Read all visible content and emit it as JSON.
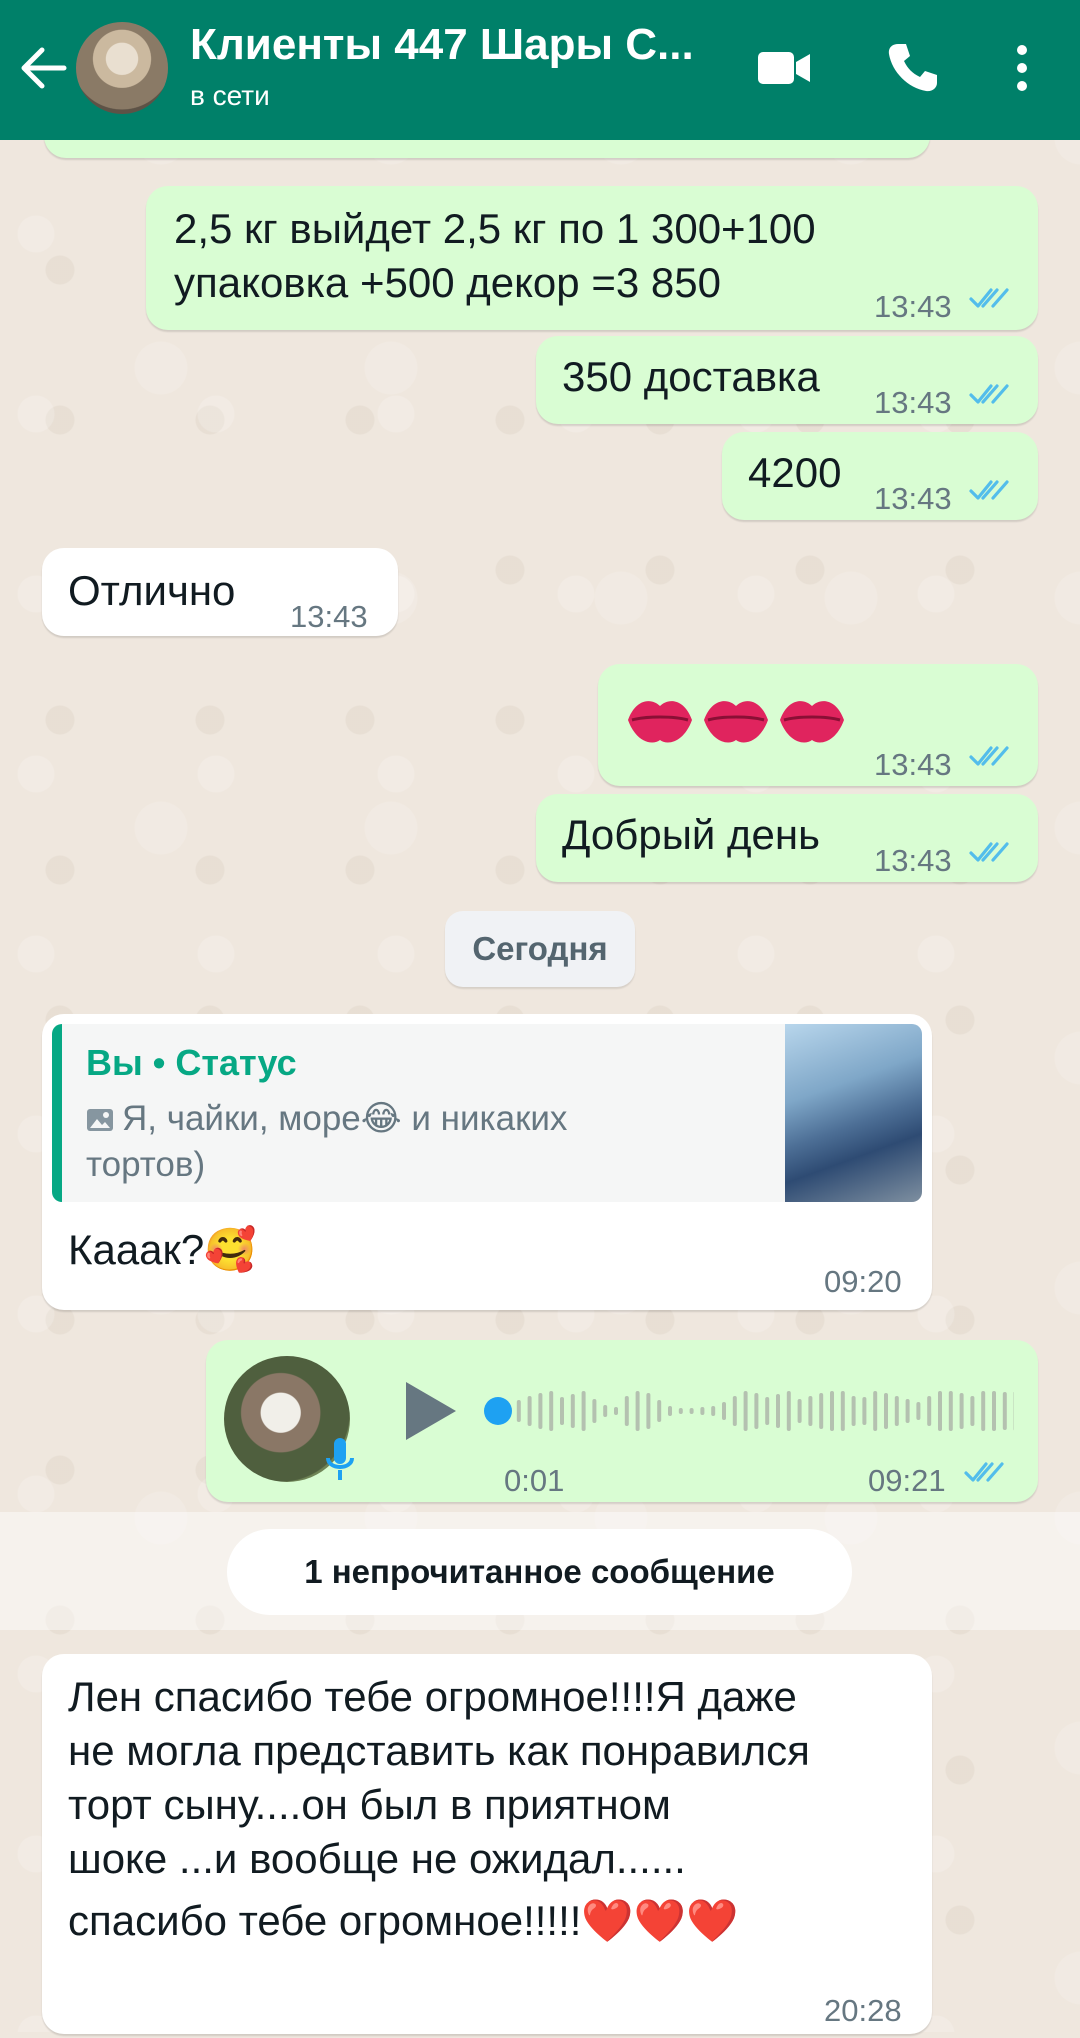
{
  "header": {
    "title": "Клиенты 447 Шары С...",
    "status": "в сети",
    "icons": [
      "arrow-left-icon",
      "video-call-icon",
      "phone-icon",
      "more-vert-icon"
    ]
  },
  "colors": {
    "header_bg": "#008069",
    "outgoing_bubble": "#d9fdd3",
    "incoming_bubble": "#ffffff",
    "read_ticks": "#53bdeb",
    "accent": "#06a884"
  },
  "messages": [
    {
      "dir": "out",
      "text_line1": "2,5 кг выйдет 2,5 кг по 1 300+100",
      "text_line2": "упаковка +500 декор =3 850",
      "time": "13:43",
      "read": true
    },
    {
      "dir": "out",
      "text": "350 доставка",
      "time": "13:43",
      "read": true
    },
    {
      "dir": "out",
      "text": "4200",
      "time": "13:43",
      "read": true
    },
    {
      "dir": "in",
      "text": "Отлично",
      "time": "13:43"
    },
    {
      "dir": "out",
      "emoji": "kiss-mark x3",
      "time": "13:43",
      "read": true
    },
    {
      "dir": "out",
      "text": "Добрый день",
      "time": "13:43",
      "read": true
    }
  ],
  "date_divider": "Сегодня",
  "reply_message": {
    "quote_sender": "Вы • Статус",
    "quote_text": "Я, чайки, море😂 и никаких тортов)",
    "text": "Кааак?🥰",
    "time": "09:20"
  },
  "voice_message": {
    "elapsed": "0:01",
    "time": "09:21",
    "read": true,
    "progress": 0.0
  },
  "unread_banner": "1 непрочитанное сообщение",
  "last_message": {
    "line1": "Лен спасибо тебе огромное!!!!Я даже",
    "line2": "не могла представить как понравился",
    "line3": "торт сыну....он был в приятном",
    "line4": "шоке ...и вообще не ожидал......",
    "line5": "спасибо тебе огромное!!!!!❤️❤️❤️",
    "time": "20:28"
  }
}
